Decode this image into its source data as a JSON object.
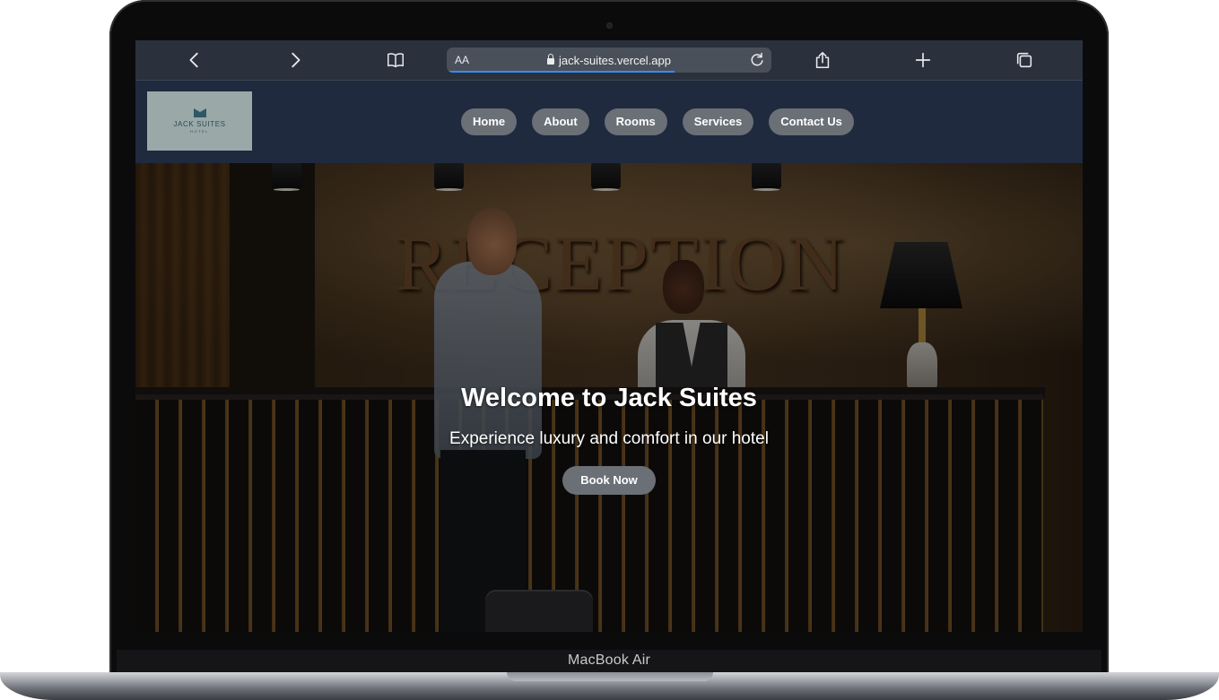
{
  "device": {
    "model_label": "MacBook Air"
  },
  "browser": {
    "text_size_label": "AA",
    "url": "jack-suites.vercel.app",
    "icons": {
      "back": "chevron-left-icon",
      "forward": "chevron-right-icon",
      "bookmarks": "book-icon",
      "lock": "lock-icon",
      "reload": "reload-icon",
      "share": "share-icon",
      "new_tab": "plus-icon",
      "tabs": "tabs-icon"
    },
    "accent_color": "#3a8bff"
  },
  "site": {
    "logo": {
      "name": "JACK SUITES",
      "sub": "HOTEL"
    },
    "nav": [
      {
        "label": "Home"
      },
      {
        "label": "About"
      },
      {
        "label": "Rooms"
      },
      {
        "label": "Services"
      },
      {
        "label": "Contact Us"
      }
    ],
    "hero": {
      "background_sign": "RECEPTION",
      "title": "Welcome to Jack Suites",
      "subtitle": "Experience luxury and comfort in our hotel",
      "cta_label": "Book Now"
    },
    "colors": {
      "header_bg": "#1f2a3f",
      "button_bg": "#6b6f76",
      "text": "#ffffff"
    }
  }
}
